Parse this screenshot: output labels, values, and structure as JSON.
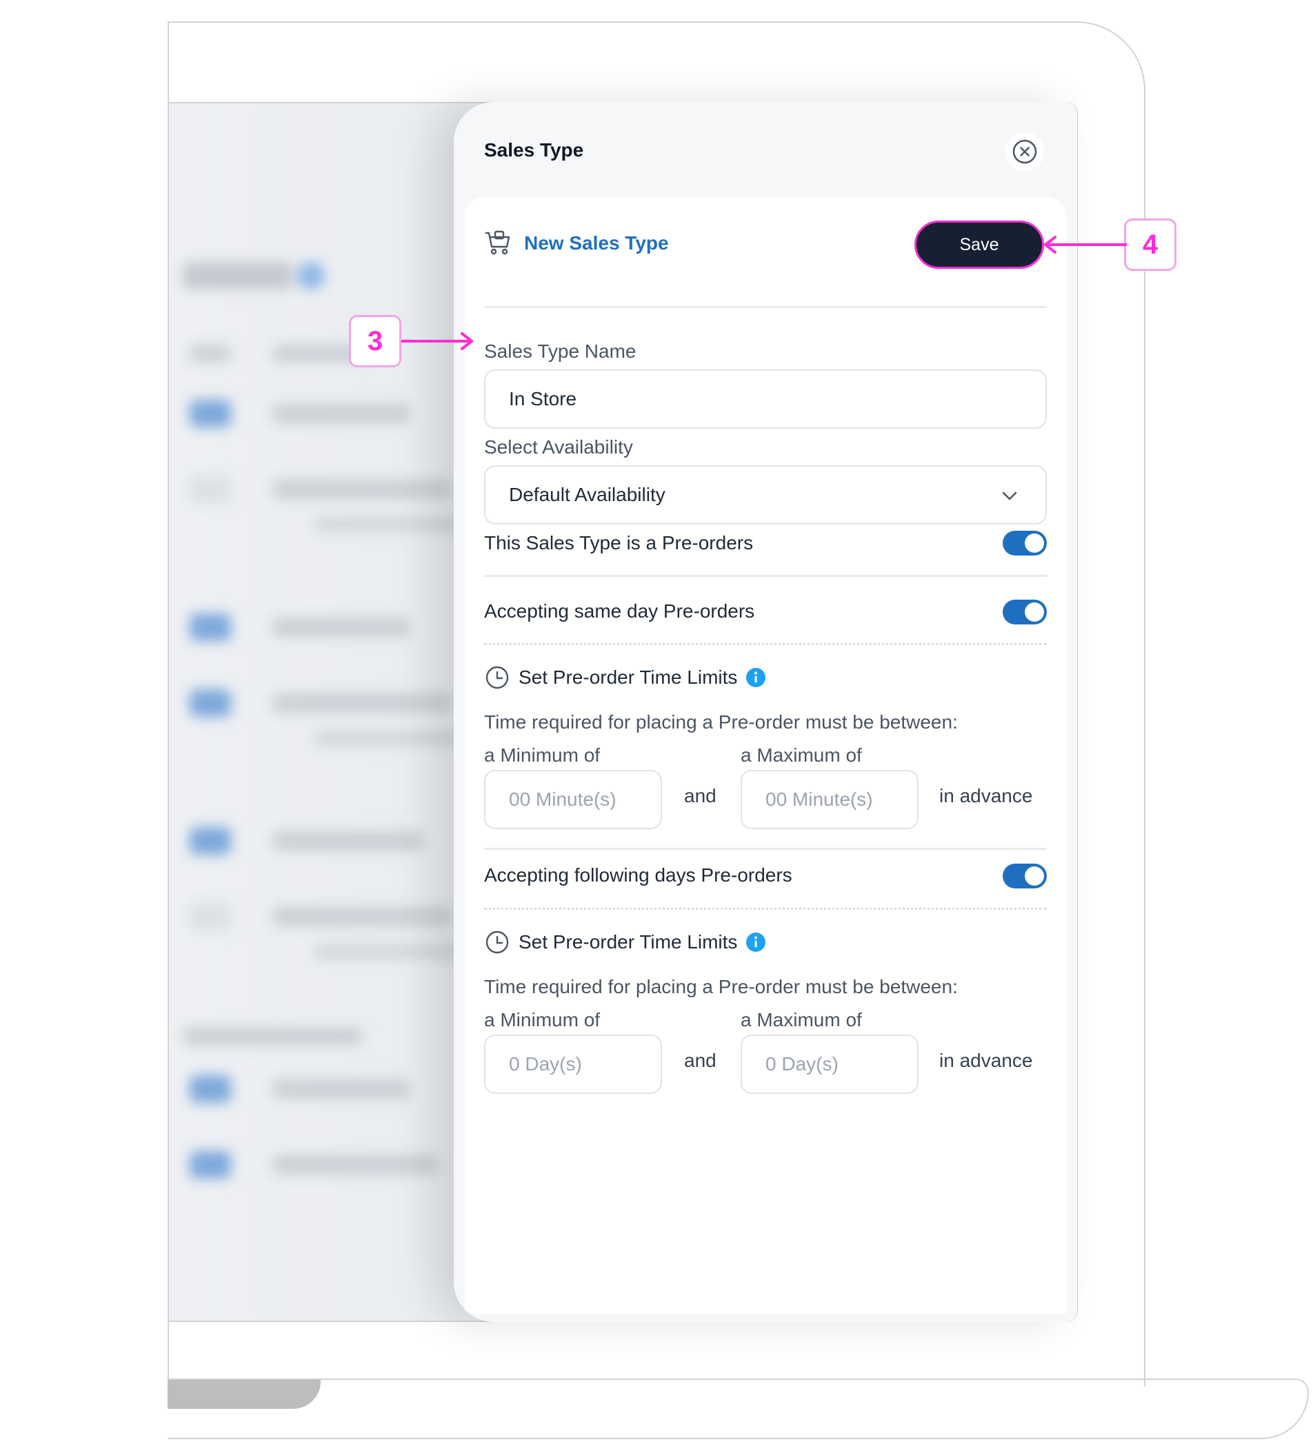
{
  "modal": {
    "title": "Sales Type",
    "header_title": "New Sales Type",
    "save_label": "Save",
    "name_label": "Sales Type Name",
    "name_value": "In Store",
    "availability_label": "Select Availability",
    "availability_value": "Default Availability",
    "preorder_toggle_label": "This Sales Type is a Pre-orders",
    "same_day": {
      "label": "Accepting same day Pre-orders",
      "limits_title": "Set Pre-order Time Limits",
      "description": "Time required for placing a Pre-order must be between:",
      "min_label": "a Minimum of",
      "max_label": "a Maximum of",
      "min_placeholder": "00 Minute(s)",
      "max_placeholder": "00 Minute(s)",
      "and_text": "and",
      "advance_text": "in advance"
    },
    "following_days": {
      "label": "Accepting following days Pre-orders",
      "limits_title": "Set Pre-order Time Limits",
      "description": "Time required for placing a Pre-order must be between:",
      "min_label": "a Minimum of",
      "max_label": "a Maximum of",
      "min_placeholder": "0 Day(s)",
      "max_placeholder": "0 Day(s)",
      "and_text": "and",
      "advance_text": "in advance"
    }
  },
  "toggles": {
    "preorder": true,
    "same_day": true,
    "following_days": true
  },
  "annotations": {
    "callout_3": "3",
    "callout_4": "4"
  },
  "colors": {
    "accent": "#1e6fc0",
    "save_bg": "#172032",
    "annotation": "#ff2bd6"
  },
  "icons": [
    "close-circle-icon",
    "cart-icon",
    "chevron-down-icon",
    "clock-icon",
    "info-icon"
  ]
}
